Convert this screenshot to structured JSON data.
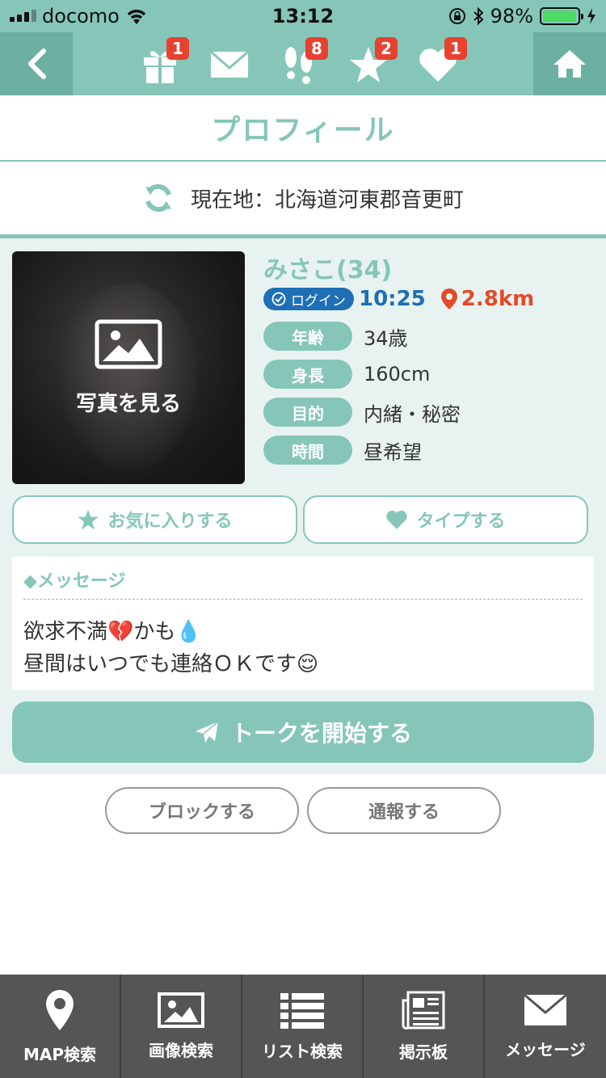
{
  "status": {
    "carrier": "docomo",
    "time": "13:12",
    "battery": "98%",
    "battery_level": 0.98
  },
  "nav": {
    "badges": {
      "gift": "1",
      "mail": "",
      "footprint": "8",
      "star": "2",
      "heart": "1"
    },
    "back_icon": "chevron-left-icon",
    "home_icon": "home-icon"
  },
  "page_title": "プロフィール",
  "location": {
    "text": "現在地：北海道河東郡音更町"
  },
  "profile": {
    "name": "みさこ(34)",
    "photo_label": "写真を見る",
    "login_label": "ログイン",
    "login_time": "10:25",
    "distance": "2.8km",
    "attributes": [
      {
        "key": "年齢",
        "value": "34歳"
      },
      {
        "key": "身長",
        "value": "160cm"
      },
      {
        "key": "目的",
        "value": "内緒・秘密"
      },
      {
        "key": "時間",
        "value": "昼希望"
      }
    ]
  },
  "actions": {
    "favorite": "お気に入りする",
    "type": "タイプする"
  },
  "message": {
    "heading": "◆メッセージ",
    "line1": "欲求不満💔かも💧",
    "line2": "昼間はいつでも連絡ＯＫです😌"
  },
  "talk_button": "トークを開始する",
  "block_button": "ブロックする",
  "report_button": "通報する",
  "tabs": [
    {
      "label": "MAP検索",
      "icon": "map-pin-icon"
    },
    {
      "label": "画像検索",
      "icon": "image-icon"
    },
    {
      "label": "リスト検索",
      "icon": "list-icon"
    },
    {
      "label": "掲示板",
      "icon": "bulletin-board-icon"
    },
    {
      "label": "メッセージ",
      "icon": "mail-icon"
    }
  ],
  "colors": {
    "accent": "#86c6b9",
    "accent_dark": "#6cb0a2",
    "badge": "#e8412f",
    "login": "#1e6fb5",
    "distance": "#e34a2a"
  }
}
